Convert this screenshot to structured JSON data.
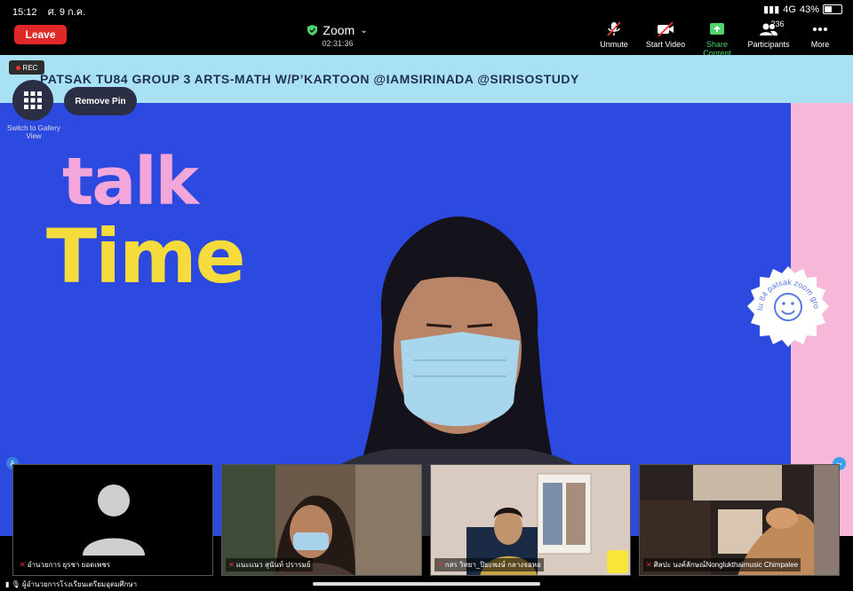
{
  "status_bar": {
    "time": "15:12",
    "date": "ศ. 9 ก.ค.",
    "network": "4G",
    "battery": "43%",
    "battery_level": 0.43
  },
  "header": {
    "leave_label": "Leave",
    "meeting_title": "Zoom",
    "timer": "02:31:36",
    "tools": [
      {
        "icon": "mic-muted-icon",
        "label": "Unmute"
      },
      {
        "icon": "video-off-icon",
        "label": "Start Video"
      },
      {
        "icon": "share-icon",
        "label": "Share Content"
      },
      {
        "icon": "participants-icon",
        "label": "Participants",
        "count": "236"
      },
      {
        "icon": "more-icon",
        "label": "More"
      }
    ]
  },
  "overlay": {
    "rec": "REC",
    "gallery_label": "Switch to Gallery View",
    "remove_pin": "Remove Pin"
  },
  "main_video": {
    "banner": "PATSAK TU84 GROUP 3 ARTS-MATH W/P’KARTOON @IAMSIRINADA @SIRISOSTUDY",
    "talk": "talk",
    "time": "Time",
    "stamp_text": "tu 84 patsak zoom group 4",
    "colors": {
      "bg": "#2d4ae0",
      "banner": "#a9e1f4",
      "pink": "#f7b7d8",
      "talk": "#f3a6d9",
      "time": "#f5dc3c"
    }
  },
  "thumbnails": [
    {
      "name": "อำนวยการ ยุรชา ยอดเพชร"
    },
    {
      "name": "แนะแนว สุนันท์ ปรารมย์"
    },
    {
      "name": "กสร วิทยา_ปิยะพงษ์ กลางจอหอ"
    },
    {
      "name": "ศิลปะ นงค์ลักษณ์Nonglukthaimusic Chimpalee"
    }
  ],
  "bottom": {
    "speaker": "ผู้อำนวยการโรงเรียนเตรียมอุดมศึกษา"
  }
}
